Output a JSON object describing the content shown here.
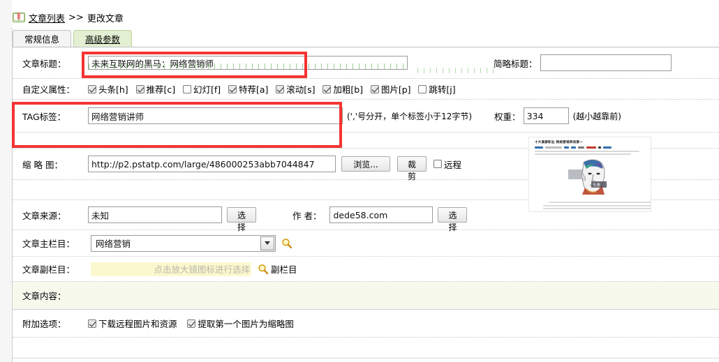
{
  "breadcrumb": {
    "icon": "book-icon",
    "link": "文章列表",
    "separator": ">>",
    "current": "更改文章"
  },
  "tabs": [
    {
      "label": "常规信息",
      "active": false
    },
    {
      "label": "高级参数",
      "active": true
    }
  ],
  "form": {
    "title": {
      "label": "文章标题：",
      "value": "未来互联网的黑马：网络营销师"
    },
    "short_title": {
      "label": "简略标题：",
      "value": ""
    },
    "attributes": {
      "label": "自定义属性：",
      "items": [
        {
          "label": "头条[h]",
          "checked": true
        },
        {
          "label": "推荐[c]",
          "checked": true
        },
        {
          "label": "幻灯[f]",
          "checked": false
        },
        {
          "label": "特荐[a]",
          "checked": true
        },
        {
          "label": "滚动[s]",
          "checked": true
        },
        {
          "label": "加粗[b]",
          "checked": true
        },
        {
          "label": "图片[p]",
          "checked": true
        },
        {
          "label": "跳转[j]",
          "checked": false
        }
      ]
    },
    "tags": {
      "label": "TAG标签：",
      "value": "网络营销讲师",
      "hint": "(','号分开，单个标签小于12字节)"
    },
    "weight": {
      "label": "权重：",
      "value": "334",
      "hint": "(越小越靠前)"
    },
    "thumbnail": {
      "label": "缩 略 图：",
      "value": "http://p2.pstatp.com/large/486000253abb7044847",
      "browse_button": "浏览...",
      "crop_button": "裁剪",
      "remote_label": "远程",
      "remote_checked": false,
      "preview_title": "十大高薪职业 网络营销师排第一"
    },
    "source": {
      "label": "文章来源：",
      "value": "未知",
      "choose_button": "选择"
    },
    "author": {
      "label": "作 者：",
      "value": "dede58.com",
      "choose_button": "选择"
    },
    "main_column": {
      "label": "文章主栏目：",
      "value": "网络营销",
      "search_icon": "magnifier-icon"
    },
    "sub_column": {
      "label": "文章副栏目：",
      "placeholder": "点击放大镜图标进行选择",
      "search_icon": "magnifier-icon",
      "link_label": "副栏目"
    },
    "content": {
      "label": "文章内容："
    },
    "extra_options": {
      "label": "附加选项：",
      "items": [
        {
          "label": "下载远程图片和资源",
          "checked": true
        },
        {
          "label": "提取第一个图片为缩略图",
          "checked": true
        }
      ]
    }
  },
  "annotations": [
    {
      "name": "title-highlight",
      "color": "#f53434"
    },
    {
      "name": "tag-highlight",
      "color": "#f53434"
    }
  ]
}
